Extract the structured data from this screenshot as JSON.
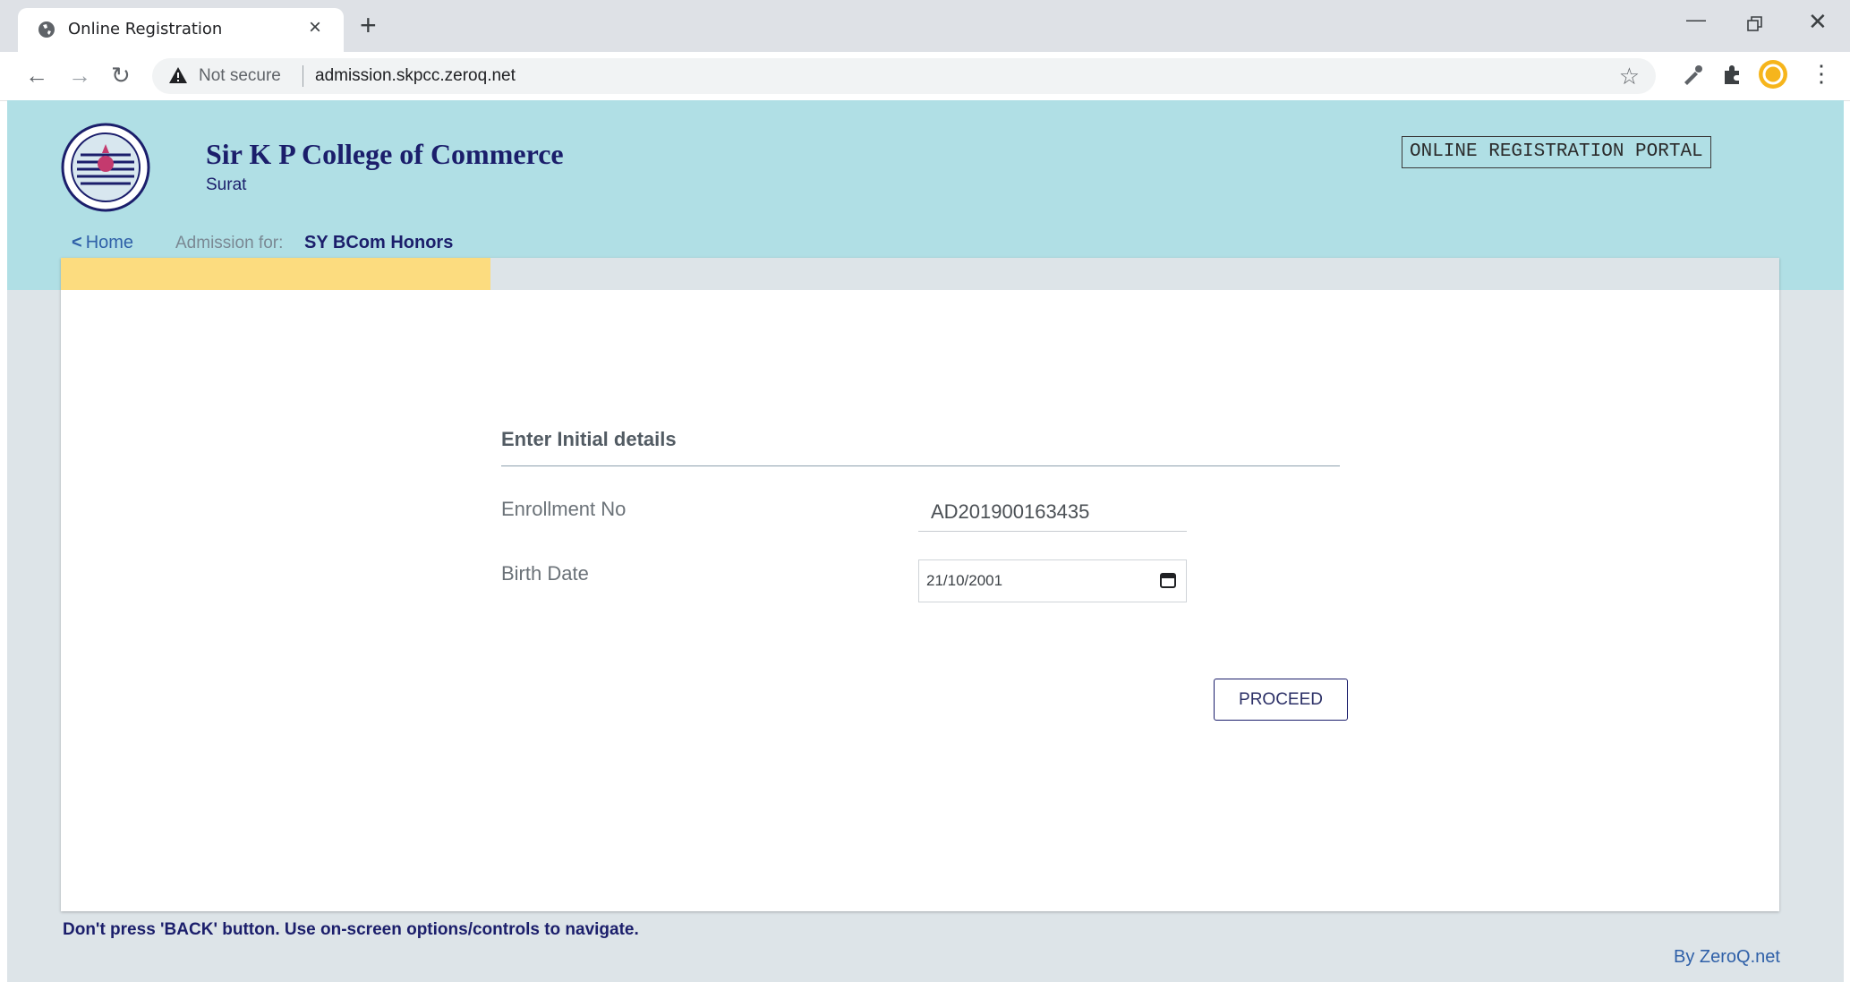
{
  "browser": {
    "tab_title": "Online Registration",
    "tab_close": "×",
    "new_tab": "+",
    "security_label": "Not secure",
    "url": "admission.skpcc.zeroq.net"
  },
  "header": {
    "college_name": "Sir K P College of Commerce",
    "college_city": "Surat",
    "portal_label": "ONLINE REGISTRATION PORTAL",
    "home_link": "Home",
    "admission_label": "Admission for:",
    "admission_value": "SY BCom Honors"
  },
  "progress": {
    "fraction": 0.25
  },
  "form": {
    "title": "Enter Initial details",
    "enrollment_label": "Enrollment No",
    "enrollment_value": "AD201900163435",
    "birth_label": "Birth Date",
    "birth_value": "21/10/2001",
    "proceed_label": "PROCEED"
  },
  "footer": {
    "note": "Don't press 'BACK' button. Use on-screen options/controls to navigate.",
    "byline": "By ZeroQ.net"
  },
  "icons": {
    "tab_favicon": "globe-icon",
    "back": "back-arrow-icon",
    "forward": "forward-arrow-icon",
    "reload": "reload-icon",
    "security": "warning-icon",
    "bookmark": "star-icon",
    "extensions": [
      "eyedropper-icon",
      "puzzle-icon",
      "profile-avatar-icon"
    ],
    "menu": "kebab-menu-icon",
    "date_picker": "calendar-icon"
  },
  "colors": {
    "header_band": "#b0dfe5",
    "brand_navy": "#1b1e6b",
    "progress_fill": "#fcdc7f",
    "link_blue": "#2f60a8"
  }
}
